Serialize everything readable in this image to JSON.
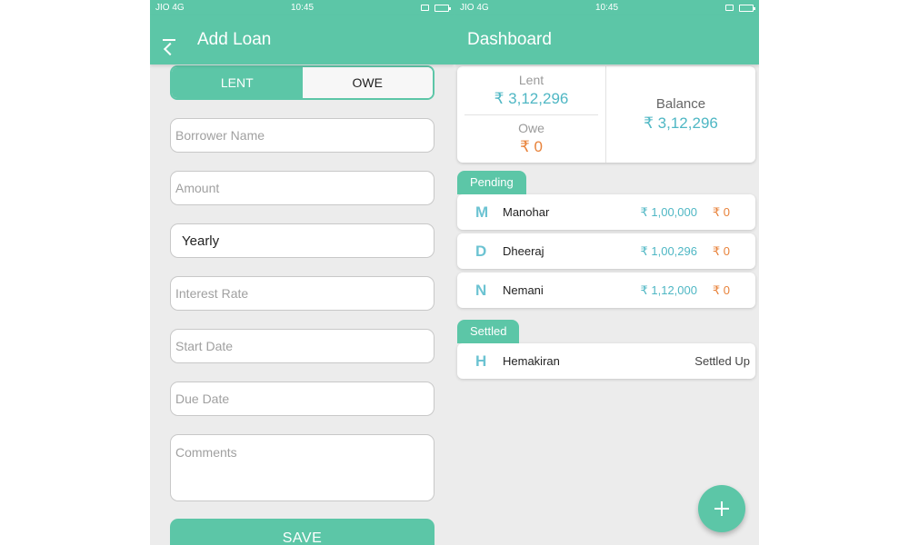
{
  "status_bar": {
    "carrier": "JIO 4G",
    "time": "10:45"
  },
  "add_loan": {
    "title": "Add Loan",
    "segments": [
      "LENT",
      "OWE"
    ],
    "borrower_placeholder": "Borrower Name",
    "amount_placeholder": "Amount",
    "frequency_value": "Yearly",
    "interest_placeholder": "Interest Rate",
    "start_date_placeholder": "Start Date",
    "due_date_placeholder": "Due Date",
    "comments_placeholder": "Comments",
    "save_label": "SAVE"
  },
  "dashboard": {
    "title": "Dashboard",
    "lent_label": "Lent",
    "lent_value": "₹ 3,12,296",
    "owe_label": "Owe",
    "owe_value": "₹ 0",
    "balance_label": "Balance",
    "balance_value": "₹ 3,12,296",
    "pending_label": "Pending",
    "pending": [
      {
        "initial": "M",
        "name": "Manohar",
        "amount": "₹ 1,00,000",
        "owed": "₹ 0"
      },
      {
        "initial": "D",
        "name": "Dheeraj",
        "amount": "₹ 1,00,296",
        "owed": "₹ 0"
      },
      {
        "initial": "N",
        "name": "Nemani",
        "amount": "₹ 1,12,000",
        "owed": "₹ 0"
      }
    ],
    "settled_label": "Settled",
    "settled": [
      {
        "initial": "H",
        "name": "Hemakiran",
        "status": "Settled Up"
      }
    ]
  },
  "colors": {
    "primary": "#5cc6a7",
    "lent_text": "#4fb7c4",
    "owe_text": "#e8823a"
  }
}
